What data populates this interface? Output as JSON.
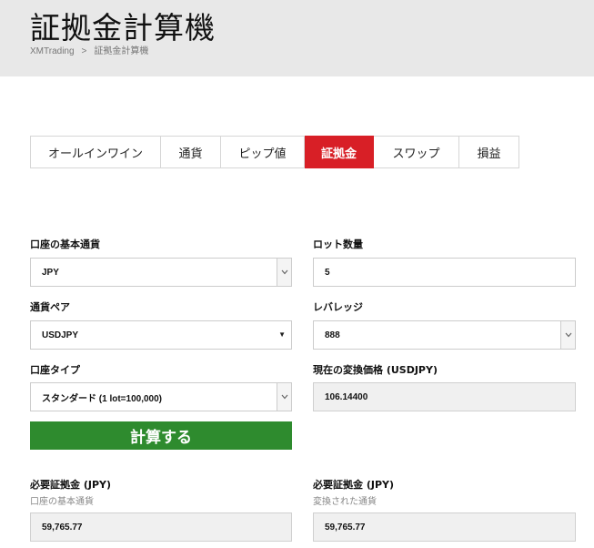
{
  "header": {
    "title": "証拠金計算機",
    "breadcrumb": [
      "XMTrading",
      "証拠金計算機"
    ],
    "breadcrumb_sep": ">"
  },
  "tabs": [
    {
      "label": "オールインワイン",
      "active": false
    },
    {
      "label": "通貨",
      "active": false
    },
    {
      "label": "ピップ値",
      "active": false
    },
    {
      "label": "証拠金",
      "active": true
    },
    {
      "label": "スワップ",
      "active": false
    },
    {
      "label": "損益",
      "active": false
    }
  ],
  "form": {
    "base_currency": {
      "label": "口座の基本通貨",
      "value": "JPY"
    },
    "lot": {
      "label": "ロット数量",
      "value": "5"
    },
    "pair": {
      "label": "通貨ペア",
      "value": "USDJPY"
    },
    "leverage": {
      "label": "レバレッジ",
      "value": "888"
    },
    "account_type": {
      "label": "口座タイプ",
      "value": "スタンダード (1 lot=100,000)"
    },
    "rate": {
      "label": "現在の変換価格 (USDJPY)",
      "value": "106.14400"
    },
    "calculate_label": "計算する"
  },
  "results": {
    "left": {
      "label": "必要証拠金 (JPY)",
      "sublabel": "口座の基本通貨",
      "value": "59,765.77"
    },
    "right": {
      "label": "必要証拠金 (JPY)",
      "sublabel": "変換された通貨",
      "value": "59,765.77"
    }
  },
  "colors": {
    "accent": "#d81f26",
    "button": "#2e8b2e",
    "header_bg": "#e8e8e8"
  }
}
